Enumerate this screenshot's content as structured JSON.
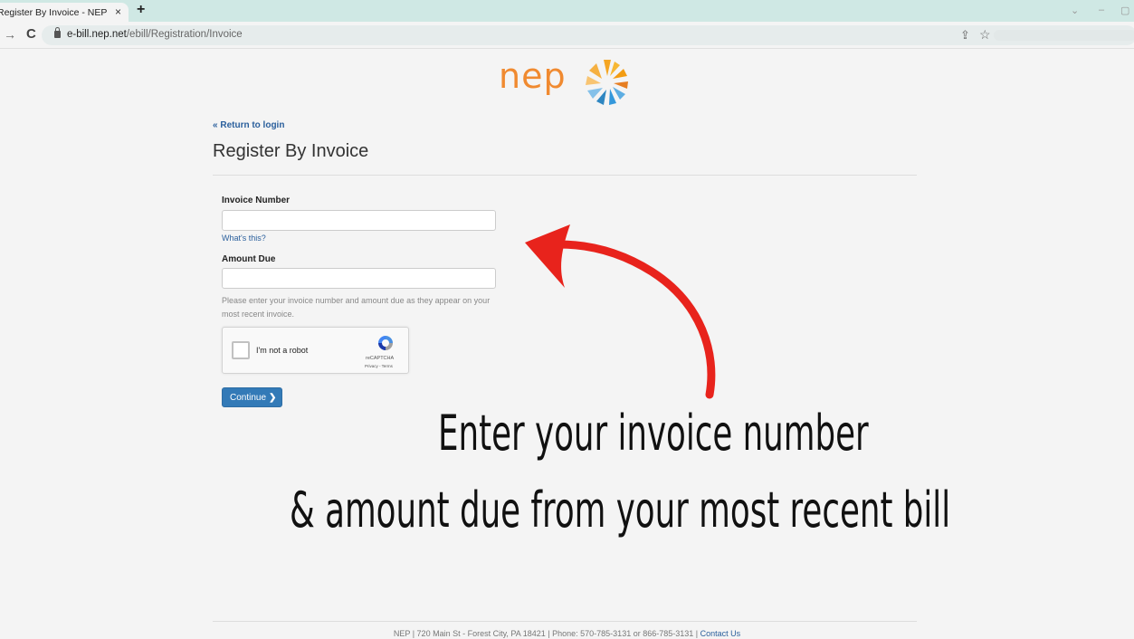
{
  "browser": {
    "tab_title": "Register By Invoice - NEP",
    "tab_close": "×",
    "new_tab": "+",
    "url_host": "e-bill.nep.net",
    "url_path": "/ebill/Registration/Invoice",
    "min_label": "–",
    "restore_label": "▢"
  },
  "logo": {
    "text": "nep"
  },
  "page": {
    "return_link": "Return to login",
    "title": "Register By Invoice"
  },
  "form": {
    "invoice_label": "Invoice Number",
    "invoice_value": "",
    "whats_this": "What's this?",
    "amount_label": "Amount Due",
    "amount_value": "",
    "help_text": "Please enter your invoice number and amount due as they appear on your most recent invoice.",
    "captcha_label": "I'm not a robot",
    "captcha_brand": "reCAPTCHA",
    "captcha_terms": "Privacy - Terms",
    "continue_label": "Continue"
  },
  "overlay": {
    "line1": "Enter your invoice number",
    "line2": "& amount due from your most recent bill",
    "arrow_color": "#e8231c"
  },
  "footer": {
    "text": "NEP | 720 Main St - Forest City, PA 18421 | Phone: 570-785-3131 or 866-785-3131 | ",
    "contact_label": "Contact Us"
  },
  "colors": {
    "accent": "#337ab7",
    "logo_orange": "#f08a30",
    "link": "#2a5f9c"
  }
}
